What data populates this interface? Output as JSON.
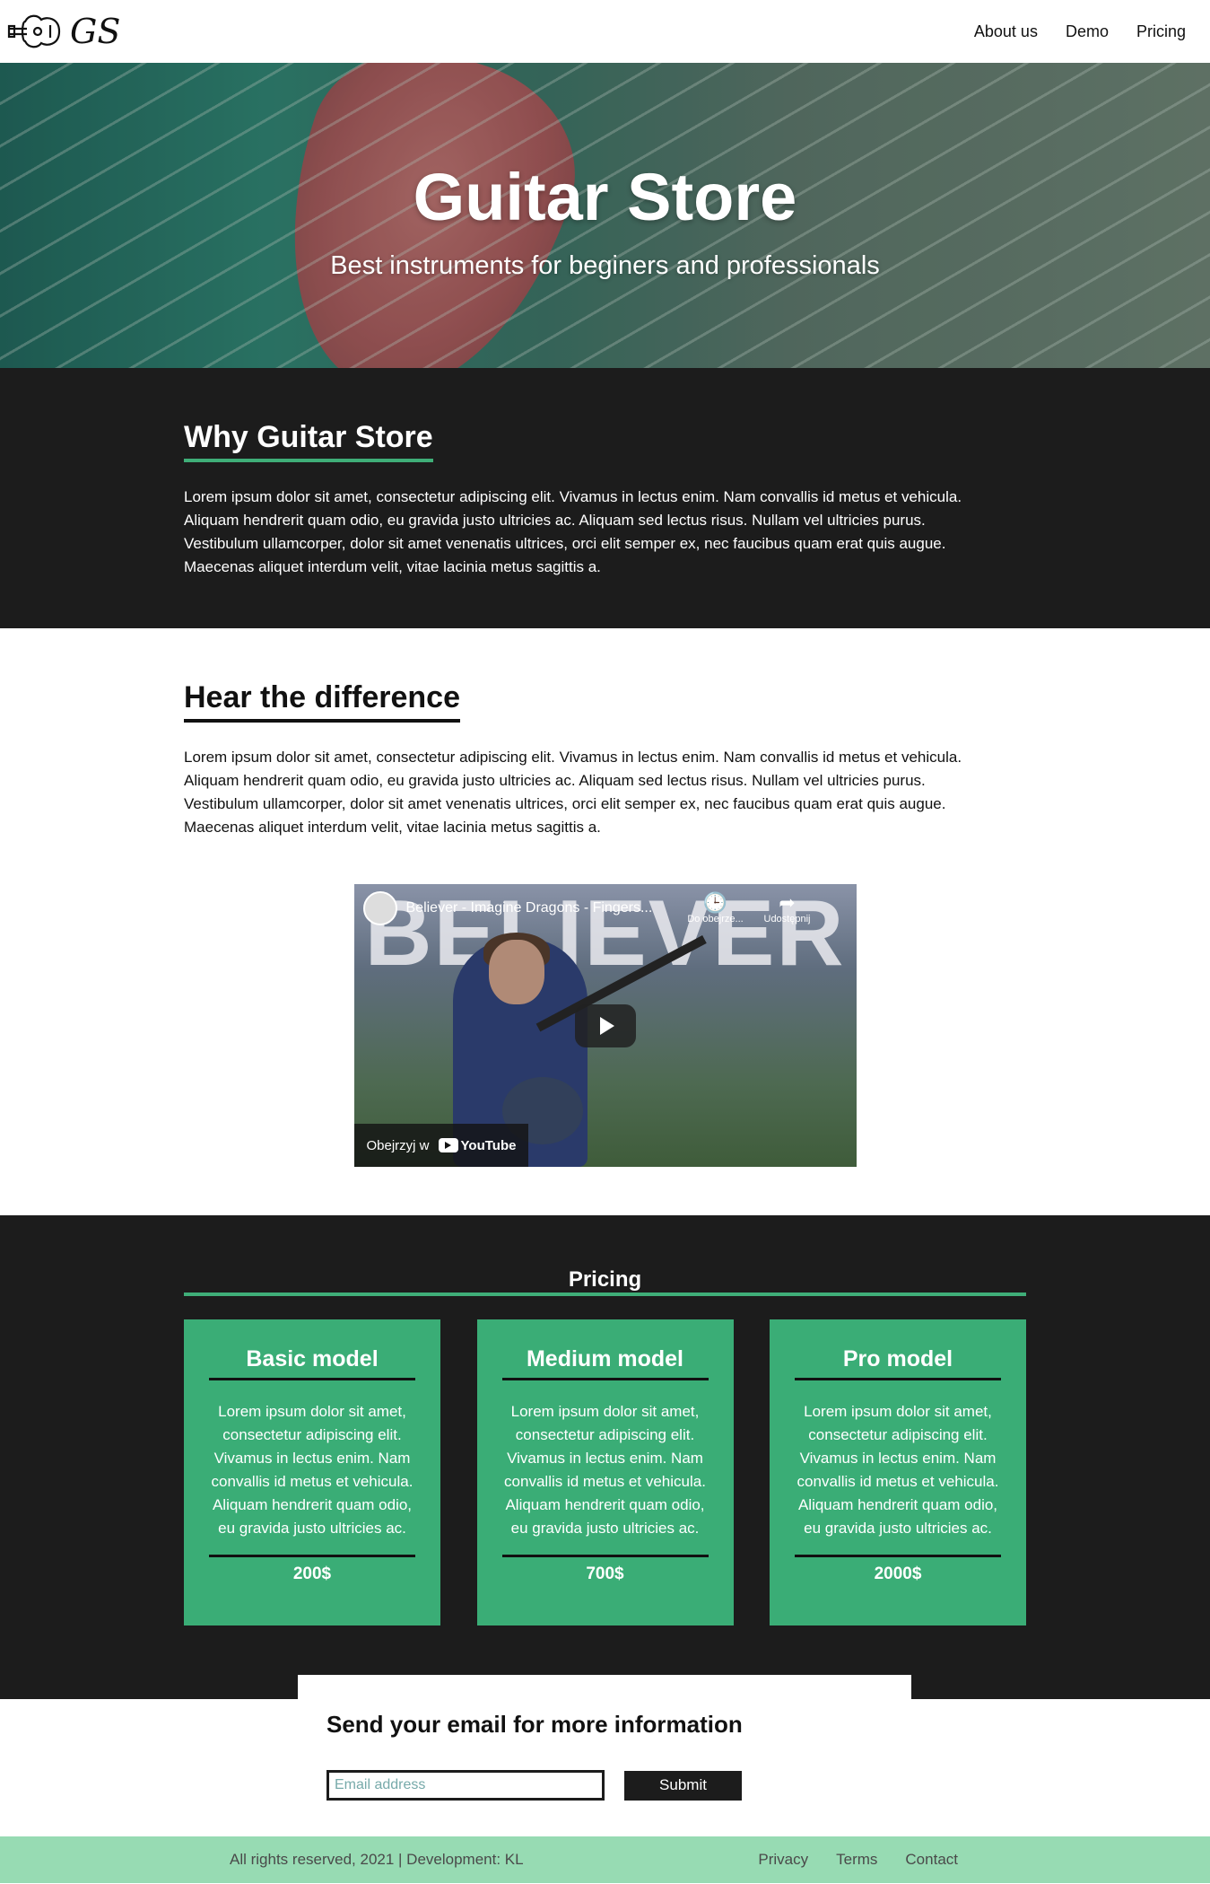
{
  "nav": {
    "logo_text": "GS",
    "links": [
      "About us",
      "Demo",
      "Pricing"
    ]
  },
  "hero": {
    "title": "Guitar Store",
    "subtitle": "Best instruments for beginers and professionals"
  },
  "why": {
    "heading": "Why Guitar Store",
    "body": "Lorem ipsum dolor sit amet, consectetur adipiscing elit. Vivamus in lectus enim. Nam convallis id metus et vehicula. Aliquam hendrerit quam odio, eu gravida justo ultricies ac. Aliquam sed lectus risus. Nullam vel ultricies purus. Vestibulum ullamcorper, dolor sit amet venenatis ultrices, orci elit semper ex, nec faucibus quam erat quis augue. Maecenas aliquet interdum velit, vitae lacinia metus sagittis a."
  },
  "hear": {
    "heading": "Hear the difference",
    "body": "Lorem ipsum dolor sit amet, consectetur adipiscing elit. Vivamus in lectus enim. Nam convallis id metus et vehicula. Aliquam hendrerit quam odio, eu gravida justo ultricies ac. Aliquam sed lectus risus. Nullam vel ultricies purus. Vestibulum ullamcorper, dolor sit amet venenatis ultrices, orci elit semper ex, nec faucibus quam erat quis augue. Maecenas aliquet interdum velit, vitae lacinia metus sagittis a.",
    "video": {
      "overlay_word": "BELIEVER",
      "title": "Believer - Imagine Dragons - Fingers...",
      "watch_later": "Do obejrze...",
      "share": "Udostępnij",
      "watch_on": "Obejrzyj w",
      "youtube": "YouTube"
    }
  },
  "pricing": {
    "heading": "Pricing",
    "cards": [
      {
        "name": "Basic model",
        "desc": "Lorem ipsum dolor sit amet, consectetur adipiscing elit. Vivamus in lectus enim. Nam convallis id metus et vehicula. Aliquam hendrerit quam odio, eu gravida justo ultricies ac.",
        "price": "200$"
      },
      {
        "name": "Medium model",
        "desc": "Lorem ipsum dolor sit amet, consectetur adipiscing elit. Vivamus in lectus enim. Nam convallis id metus et vehicula. Aliquam hendrerit quam odio, eu gravida justo ultricies ac.",
        "price": "700$"
      },
      {
        "name": "Pro model",
        "desc": "Lorem ipsum dolor sit amet, consectetur adipiscing elit. Vivamus in lectus enim. Nam convallis id metus et vehicula. Aliquam hendrerit quam odio, eu gravida justo ultricies ac.",
        "price": "2000$"
      }
    ]
  },
  "email": {
    "heading": "Send your email for more information",
    "placeholder": "Email address",
    "submit_label": "Submit"
  },
  "footer": {
    "copyright": "All rights reserved, 2021 | Development: KL",
    "links": [
      "Privacy",
      "Terms",
      "Contact"
    ]
  },
  "colors": {
    "accent": "#3aad76",
    "dark": "#1c1c1c",
    "footer_bg": "#97dbb3"
  }
}
